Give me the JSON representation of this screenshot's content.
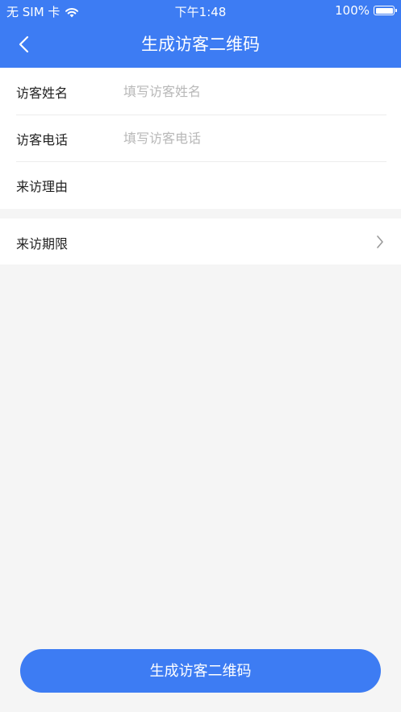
{
  "status_bar": {
    "carrier": "无 SIM 卡",
    "time": "下午1:48",
    "battery": "100%",
    "battery_level": 1.0
  },
  "nav": {
    "title": "生成访客二维码",
    "back_icon": "chevron-left-icon"
  },
  "form": {
    "name_label": "访客姓名",
    "name_placeholder": "填写访客姓名",
    "name_value": "",
    "phone_label": "访客电话",
    "phone_placeholder": "填写访客电话",
    "phone_value": "",
    "reason_label": "来访理由",
    "reason_value": ""
  },
  "period": {
    "label": "来访期限",
    "arrow_icon": "chevron-right-icon"
  },
  "submit": {
    "label": "生成访客二维码"
  },
  "colors": {
    "primary": "#3d7cf3",
    "background": "#f5f5f5",
    "placeholder": "#b8b8b8"
  }
}
